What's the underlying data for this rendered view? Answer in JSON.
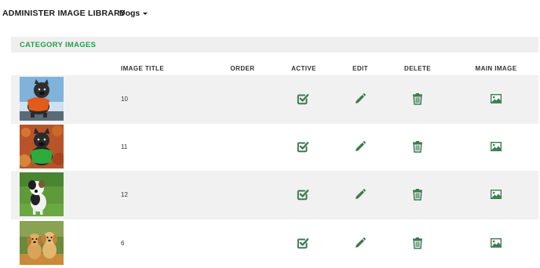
{
  "header": {
    "title": "ADMINISTER IMAGE LIBRARY",
    "category_selected": "Dogs"
  },
  "panel": {
    "title": "CATEGORY IMAGES"
  },
  "table": {
    "columns": {
      "image_title": "IMAGE TITLE",
      "order": "ORDER",
      "active": "ACTIVE",
      "edit": "EDIT",
      "delete": "DELETE",
      "main_image": "MAIN IMAGE"
    },
    "rows": [
      {
        "title": "10",
        "order": "",
        "thumbnail": "french-bulldog-orange-jacket-photo",
        "active_icon": "check-square-icon",
        "edit_icon": "pencil-icon",
        "delete_icon": "trash-icon",
        "main_image_icon": "image-icon"
      },
      {
        "title": "11",
        "order": "",
        "thumbnail": "french-bulldog-autumn-leaves-photo",
        "active_icon": "check-square-icon",
        "edit_icon": "pencil-icon",
        "delete_icon": "trash-icon",
        "main_image_icon": "image-icon"
      },
      {
        "title": "12",
        "order": "",
        "thumbnail": "puppy-on-grass-photo",
        "active_icon": "check-square-icon",
        "edit_icon": "pencil-icon",
        "delete_icon": "trash-icon",
        "main_image_icon": "image-icon"
      },
      {
        "title": "6",
        "order": "",
        "thumbnail": "two-golden-puppies-photo",
        "active_icon": "check-square-icon",
        "edit_icon": "pencil-icon",
        "delete_icon": "trash-icon",
        "main_image_icon": "image-icon"
      }
    ]
  },
  "colors": {
    "accent_green": "#2e9a48",
    "icon_green": "#3d7a52",
    "header_bg": "#efefef",
    "row_shade": "#f1f1f1"
  }
}
